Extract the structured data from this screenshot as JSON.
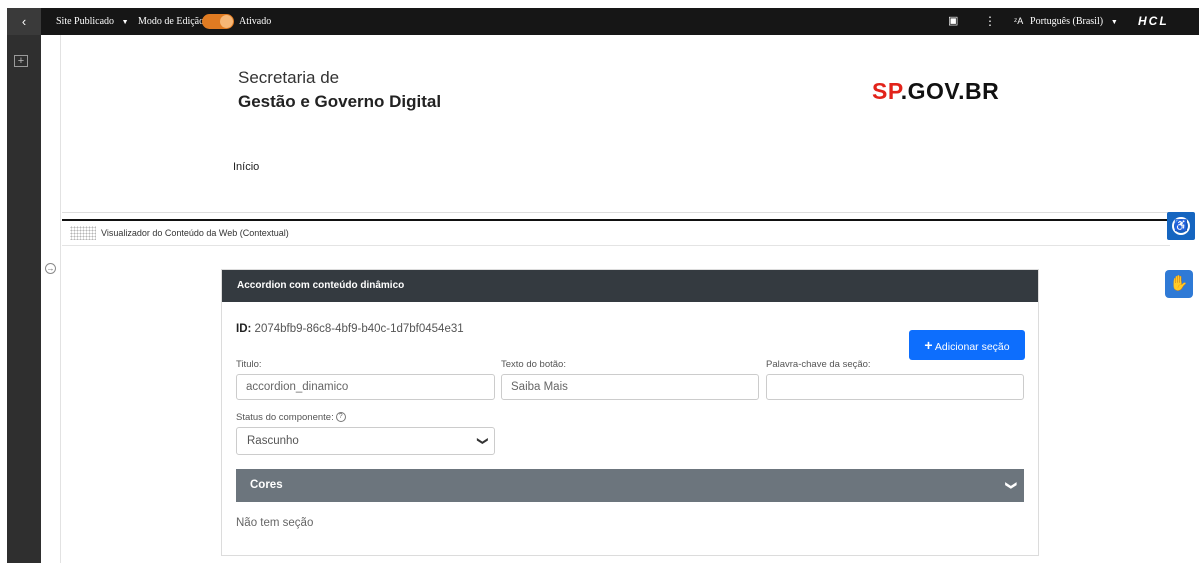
{
  "topbar": {
    "back_icon": "‹",
    "site_status": "Site Publicado",
    "edit_mode_label": "Modo de Edição:",
    "edit_mode_state": "Ativado",
    "page_icon": "▣",
    "more_icon": "⋮",
    "language": "Português (Brasil)",
    "language_icon": "ᶻA",
    "brand": "HCL",
    "toggle_color": "#e07b22"
  },
  "header": {
    "title_line1": "Secretaria de",
    "title_line2": "Gestão e Governo Digital",
    "logo_sp": "SP",
    "logo_rest": ".GOV.BR",
    "nav_home": "Início"
  },
  "portlet": {
    "title": "Visualizador do Conteúdo da Web (Contextual)"
  },
  "card": {
    "header_title": "Accordion com conteúdo dinâmico",
    "id_label": "ID:",
    "id_value": "2074bfb9-86c8-4bf9-b40c-1d7bf0454e31",
    "add_button": "Adicionar seção",
    "fields": {
      "title_label": "Titulo:",
      "title_value": "accordion_dinamico",
      "button_text_label": "Texto do botão:",
      "button_text_value": "Saiba Mais",
      "keyword_label": "Palavra-chave da seção:",
      "keyword_value": ""
    },
    "status_label": "Status do componente:",
    "status_value": "Rascunho",
    "colors_section": "Cores",
    "empty_message": "Não tem seção"
  },
  "colors": {
    "primary_button": "#0d6efd",
    "card_header": "#343a40",
    "accordion_bar": "#6c757d",
    "accessibility": "#1565c0"
  }
}
